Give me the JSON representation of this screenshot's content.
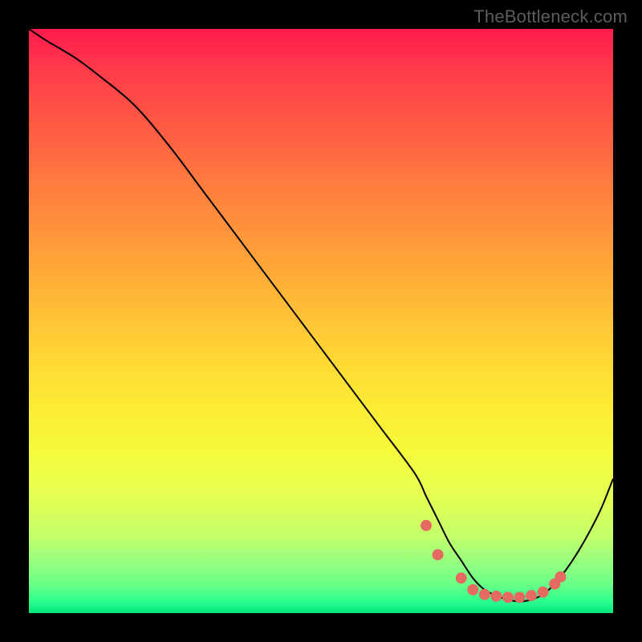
{
  "watermark": "TheBottleneck.com",
  "chart_data": {
    "type": "line",
    "title": "",
    "xlabel": "",
    "ylabel": "",
    "xlim": [
      0,
      100
    ],
    "ylim": [
      0,
      100
    ],
    "grid": false,
    "legend": false,
    "curve_color": "#000000",
    "dot_color": "#e46a62",
    "dot_radius_px": 7,
    "series": [
      {
        "name": "curve",
        "x": [
          0,
          3,
          8,
          12,
          18,
          24,
          30,
          36,
          42,
          48,
          54,
          60,
          66,
          68,
          70,
          72,
          74,
          76,
          78,
          80,
          82,
          84,
          86,
          88,
          90,
          92,
          94,
          96,
          98,
          100
        ],
        "y": [
          100,
          98,
          95,
          92,
          87,
          80,
          72,
          64,
          56,
          48,
          40,
          32,
          24,
          20,
          16,
          12,
          9,
          6,
          4,
          3,
          2.3,
          2,
          2.3,
          3.2,
          5,
          7.5,
          10.5,
          14,
          18,
          23
        ]
      }
    ],
    "dots": {
      "x": [
        68,
        70,
        74,
        76,
        78,
        80,
        82,
        84,
        86,
        88,
        90,
        91
      ],
      "y": [
        15,
        10,
        6,
        4,
        3.2,
        2.9,
        2.7,
        2.7,
        3.0,
        3.6,
        5.0,
        6.2
      ]
    }
  }
}
